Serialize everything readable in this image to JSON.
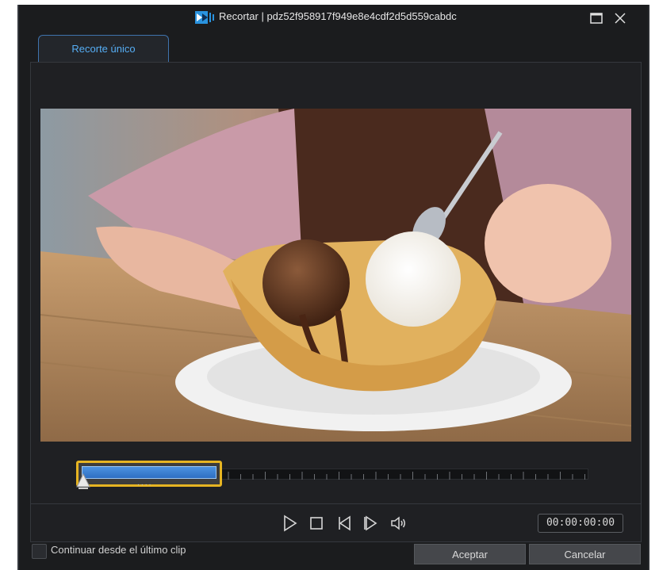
{
  "window": {
    "title": "Recortar | pdz52f958917f949e8e4cdf2d5d559cabdc",
    "logo_icon": "powerdirector-logo-icon",
    "maximize_icon": "maximize-icon",
    "close_icon": "close-icon"
  },
  "tabs": [
    {
      "label": "Recorte único",
      "active": true
    }
  ],
  "video": {
    "description_icon": "video-preview-frame"
  },
  "timeline": {
    "selection_grip": "....",
    "selection_color": "#e6b422",
    "selection_fill_color": "#3a7fd5"
  },
  "controls": {
    "play_icon": "play-icon",
    "stop_icon": "stop-icon",
    "prev_frame_icon": "previous-frame-icon",
    "next_frame_icon": "next-frame-icon",
    "volume_icon": "volume-icon",
    "timecode": "00:00:00:00"
  },
  "footer": {
    "continue_label": "Continuar desde el último clip",
    "continue_checked": false,
    "accept_label": "Aceptar",
    "cancel_label": "Cancelar"
  },
  "colors": {
    "accent": "#56aef5",
    "background": "#1b1c1e"
  }
}
